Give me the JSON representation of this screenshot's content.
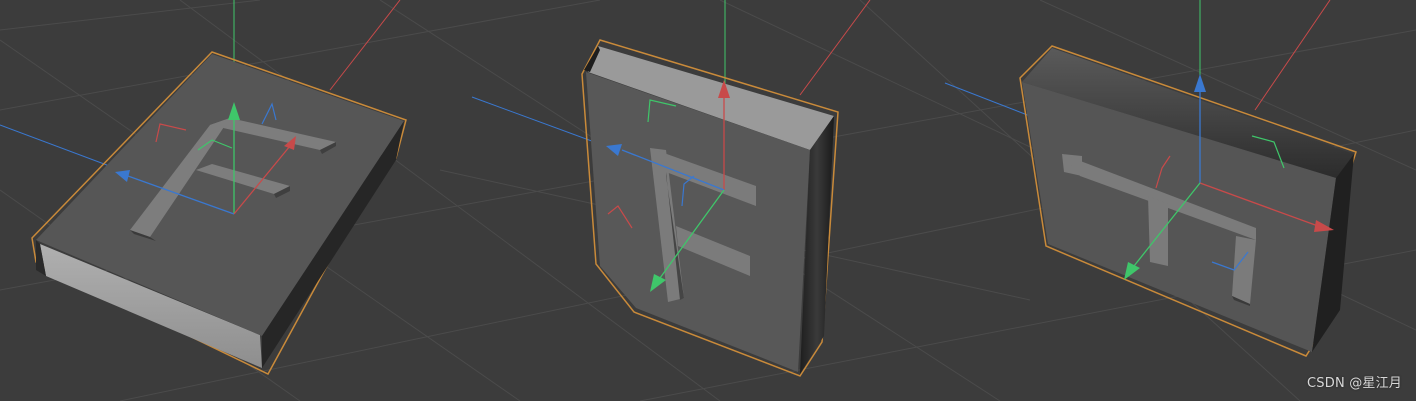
{
  "watermark": "CSDN @星江月",
  "colors": {
    "background": "#3c3c3c",
    "grid": "#4a4a4a",
    "axis_x": "#c84a4a",
    "axis_y": "#3fc66a",
    "axis_z": "#3a78d0",
    "selection_outline": "#c98a3a",
    "book_face": "#555555",
    "book_pages": "#a5a5a5",
    "letter_f": "#7c7c7c"
  },
  "objects": [
    {
      "name": "book-lying-flat",
      "letter": "F"
    },
    {
      "name": "book-standing-front",
      "letter": "F"
    },
    {
      "name": "book-standing-rotated",
      "letter": "F"
    }
  ]
}
